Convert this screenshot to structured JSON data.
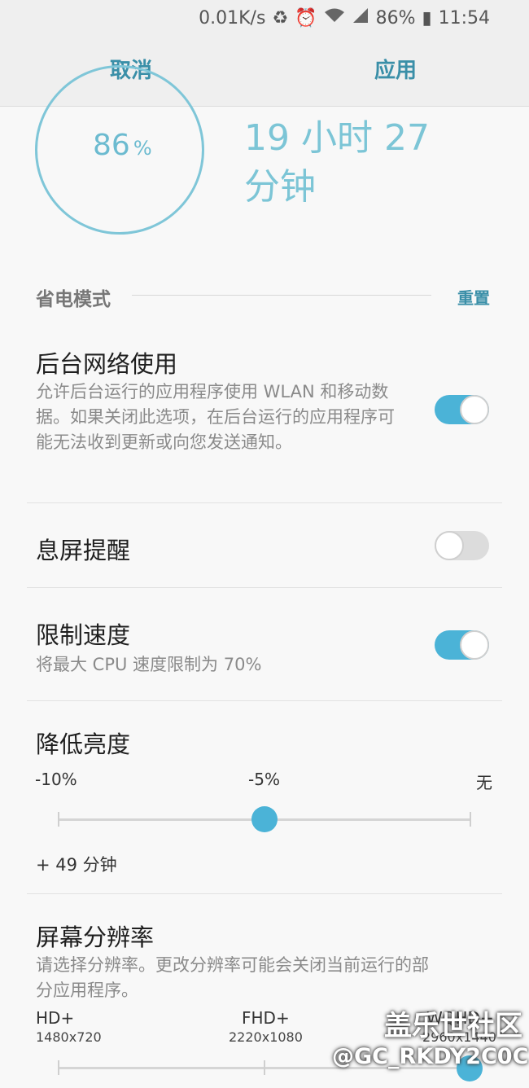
{
  "status": {
    "speed": "0.01K/s",
    "battery_icon_glyph": "▮",
    "battery": "86%",
    "time": "11:54"
  },
  "actionbar": {
    "cancel": "取消",
    "apply": "应用"
  },
  "battery_ring": {
    "value": "86",
    "unit": "%",
    "level": 0.86
  },
  "time_left": "19 小时 27 分钟",
  "section": {
    "title": "省电模式",
    "reset": "重置"
  },
  "settings": {
    "bg_network": {
      "title": "后台网络使用",
      "desc": "允许后台运行的应用程序使用 WLAN 和移动数据。如果关闭此选项，在后台运行的应用程序可能无法收到更新或向您发送通知。",
      "on": true
    },
    "aod": {
      "title": "息屏提醒",
      "on": false
    },
    "cpu_limit": {
      "title": "限制速度",
      "desc": "将最大 CPU 速度限制为 70%",
      "on": true
    },
    "brightness": {
      "title": "降低亮度",
      "labels": [
        "-10%",
        "-5%",
        "无"
      ],
      "selected_index": 1,
      "extra": "+ 49 分钟"
    },
    "resolution": {
      "title": "屏幕分辨率",
      "desc": "请选择分辨率。更改分辨率可能会关闭当前运行的部分应用程序。",
      "options": [
        {
          "name": "HD+",
          "size": "1480x720"
        },
        {
          "name": "FHD+",
          "size": "2220x1080"
        },
        {
          "name": "WQHD+",
          "size": "2960x1440"
        }
      ],
      "selected_index": 2
    }
  },
  "watermark": {
    "line1": "盖乐世社区",
    "line2": "@GC_RKDY2C0C"
  }
}
